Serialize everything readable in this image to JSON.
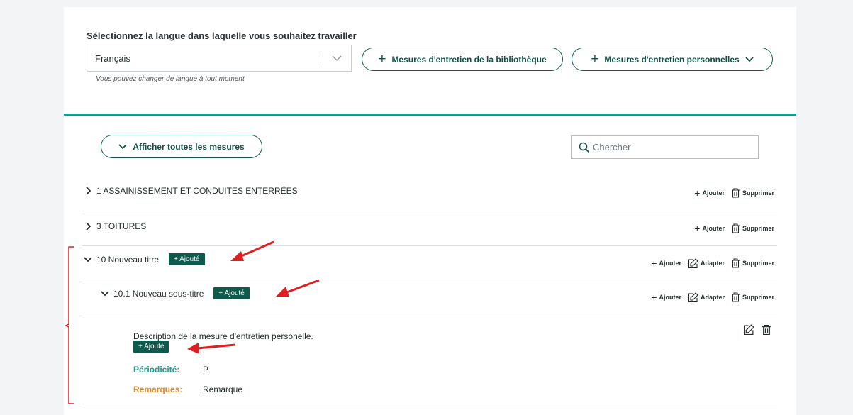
{
  "language": {
    "label": "Sélectionnez la langue dans laquelle vous souhaitez travailler",
    "selected": "Français",
    "hint": "Vous pouvez changer de langue à tout moment"
  },
  "buttons": {
    "library_measures": "Mesures d'entretien de la bibliothèque",
    "personal_measures": "Mesures d'entretien personnelles",
    "show_all": "Afficher toutes les mesures"
  },
  "search": {
    "placeholder": "Chercher"
  },
  "actions": {
    "add": "Ajouter",
    "adapt": "Adapter",
    "delete": "Supprimer"
  },
  "badge_label": "Ajouté",
  "rows": [
    {
      "title": "1 ASSAINISSEMENT ET CONDUITES ENTERRÉES"
    },
    {
      "title": "3 TOITURES"
    },
    {
      "title": "10 Nouveau titre"
    },
    {
      "title": "10.1 Nouveau sous-titre"
    }
  ],
  "measure": {
    "description": "Description de la mesure d'entretien personelle.",
    "periodicity_label": "Périodicité:",
    "periodicity_value": "P",
    "remarks_label": "Remarques:",
    "remarks_value": "Remarque"
  },
  "colors": {
    "accent": "#1b9b8b",
    "badge": "#0d5a4c",
    "periodicity": "#1b9b8b",
    "remarks": "#e8892b",
    "annotation": "#e02020"
  }
}
